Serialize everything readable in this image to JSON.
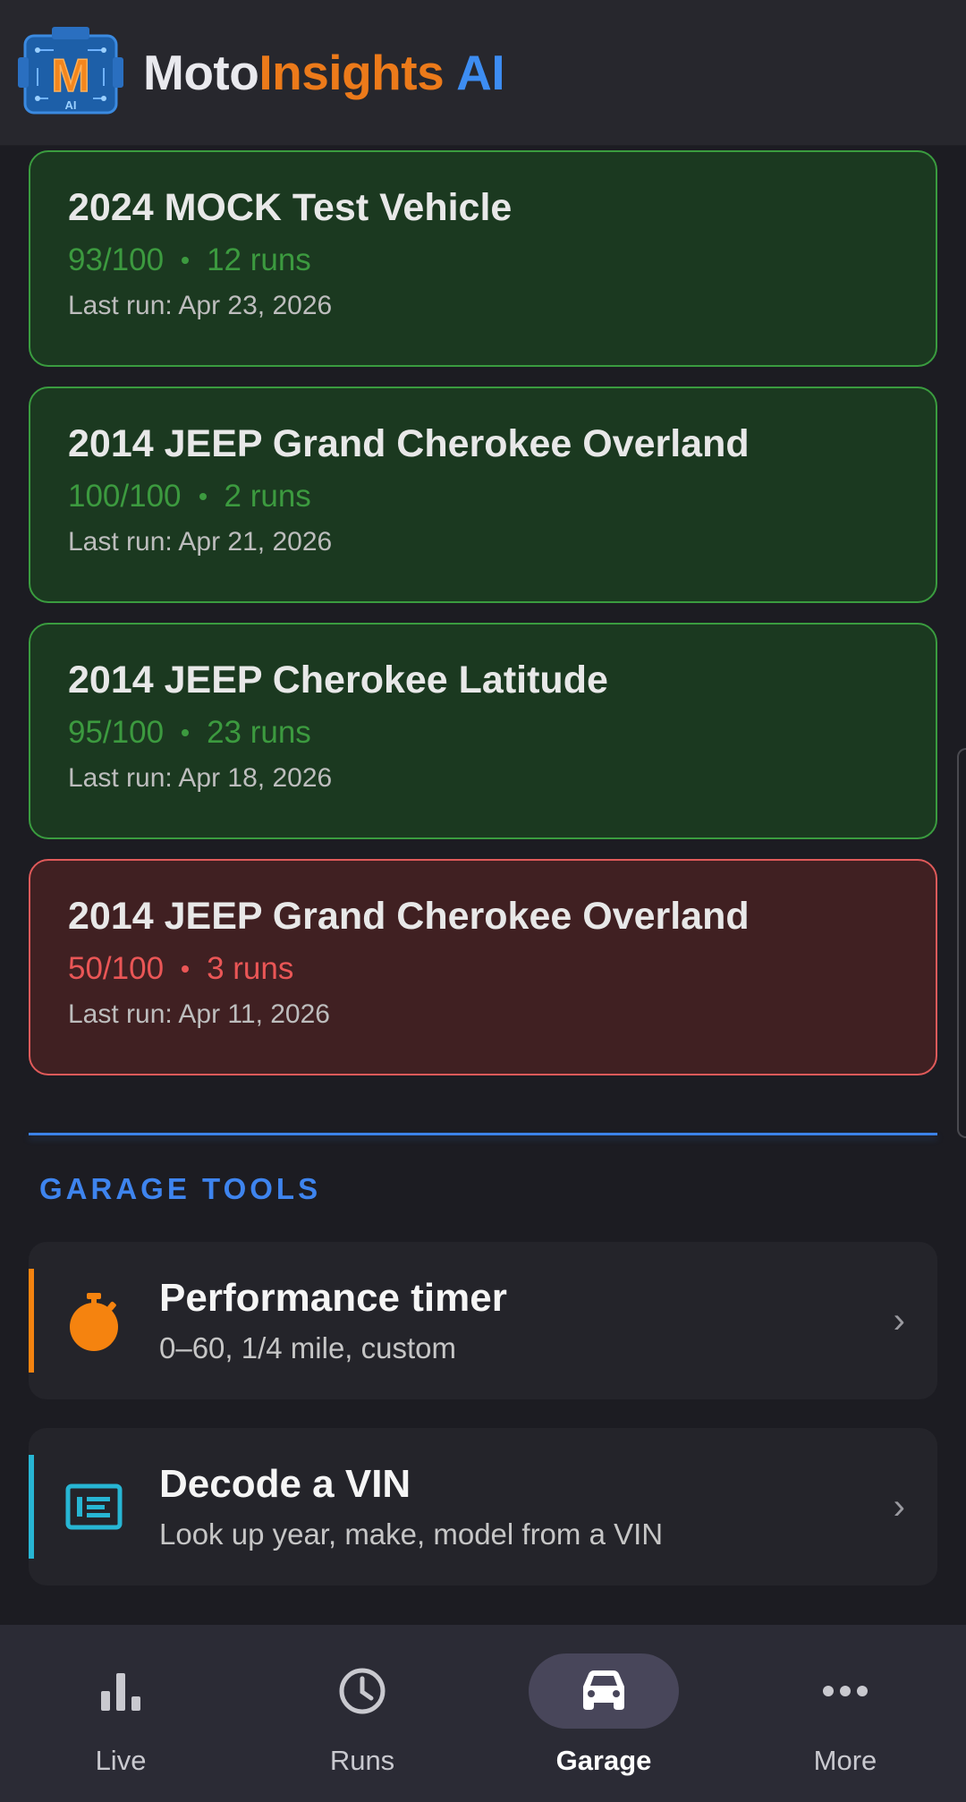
{
  "header": {
    "brand_part1": "Moto",
    "brand_part2": "Insights",
    "brand_part3": "AI",
    "logo_letter": "M",
    "logo_sub": "AI"
  },
  "vehicles": [
    {
      "title": "2024 MOCK Test Vehicle",
      "score": "93/100",
      "runs": "12 runs",
      "last_run": "Last run: Apr 23, 2026",
      "status": "good"
    },
    {
      "title": "2014 JEEP Grand Cherokee Overland",
      "score": "100/100",
      "runs": "2 runs",
      "last_run": "Last run: Apr 21, 2026",
      "status": "good"
    },
    {
      "title": "2014 JEEP Cherokee Latitude",
      "score": "95/100",
      "runs": "23 runs",
      "last_run": "Last run: Apr 18, 2026",
      "status": "good"
    },
    {
      "title": "2014 JEEP Grand Cherokee Overland",
      "score": "50/100",
      "runs": "3 runs",
      "last_run": "Last run: Apr 11, 2026",
      "status": "bad"
    }
  ],
  "garage_tools": {
    "section_title": "GARAGE TOOLS",
    "items": [
      {
        "title": "Performance timer",
        "subtitle": "0–60, 1/4 mile, custom",
        "icon": "stopwatch-icon",
        "accent": "#f5830f"
      },
      {
        "title": "Decode a VIN",
        "subtitle": "Look up year, make, model from a VIN",
        "icon": "vin-card-icon",
        "accent": "#27b6d4"
      }
    ],
    "chevron": "›"
  },
  "nav": {
    "items": [
      {
        "label": "Live",
        "icon": "bar-chart-icon"
      },
      {
        "label": "Runs",
        "icon": "clock-icon"
      },
      {
        "label": "Garage",
        "icon": "car-icon",
        "active": true
      },
      {
        "label": "More",
        "icon": "more-dots-icon"
      }
    ]
  },
  "colors": {
    "good": "#3a9c3f",
    "bad": "#e05a5a",
    "accent_blue": "#3d8df2",
    "accent_orange": "#ec7a1a"
  }
}
